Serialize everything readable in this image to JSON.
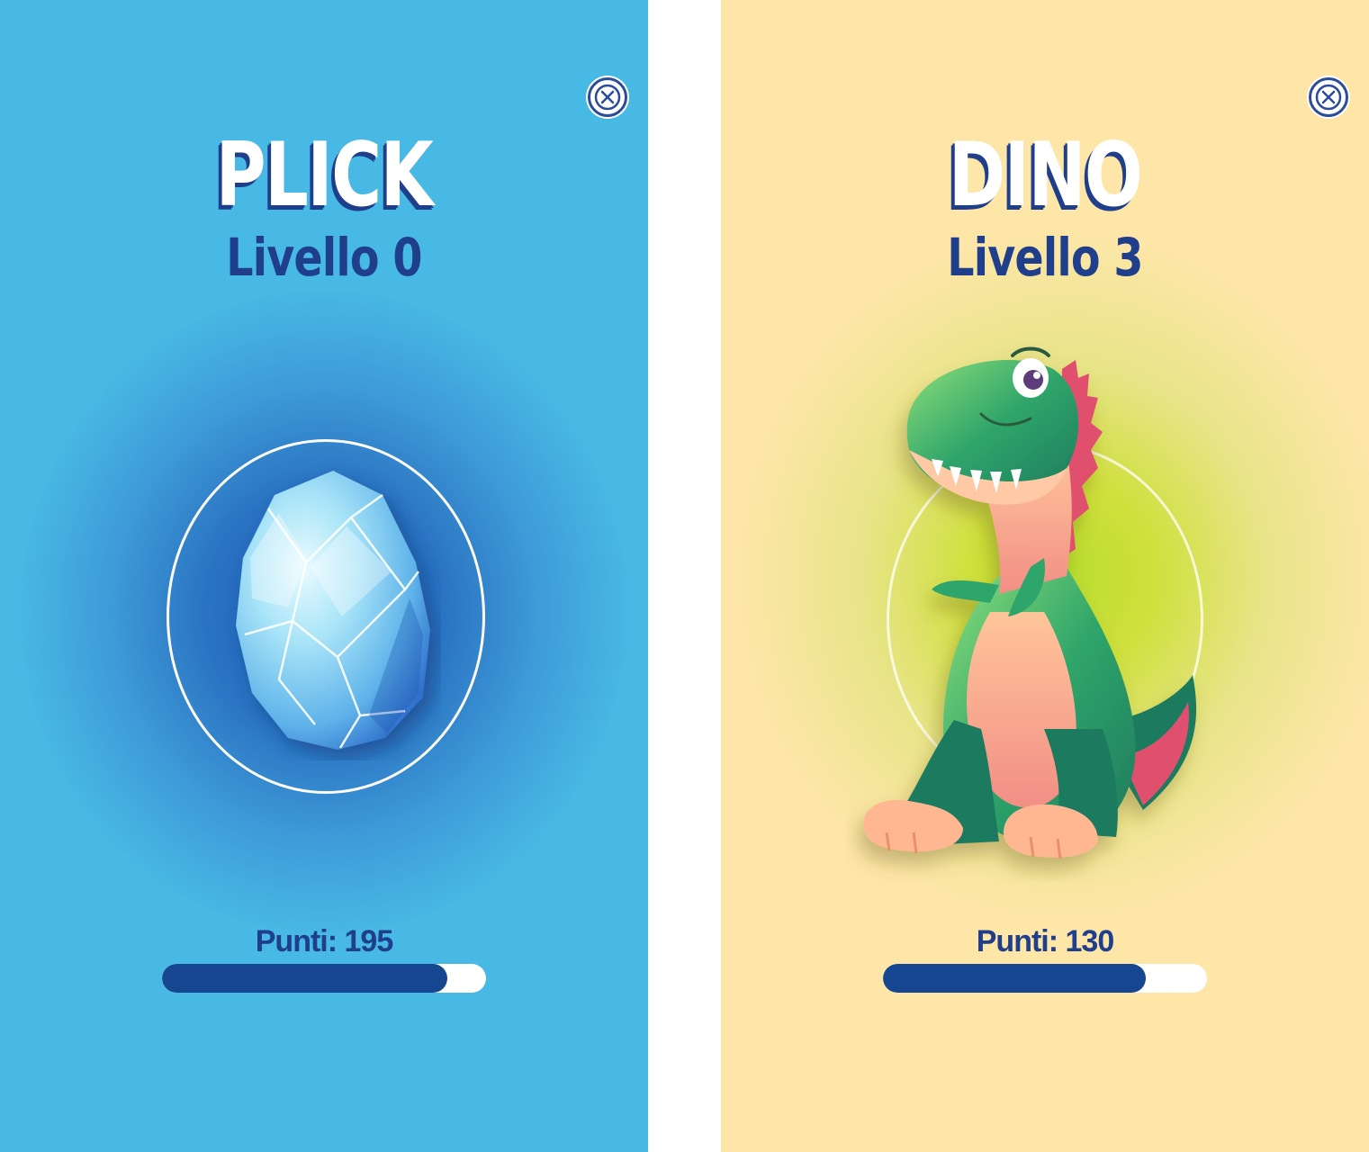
{
  "screens": [
    {
      "id": "plick",
      "name": "PLICK",
      "level_label": "Livello 0",
      "points_label": "Punti: 195",
      "progress": 0.88,
      "background": "#48b8e4",
      "creature": "crystal-egg"
    },
    {
      "id": "dino",
      "name": "DINO",
      "level_label": "Livello 3",
      "points_label": "Punti: 130",
      "progress": 0.81,
      "background": "#fde6a8",
      "creature": "green-t-rex"
    }
  ],
  "icons": {
    "close": "close-icon"
  },
  "colors": {
    "text_dark_blue": "#1f3e8c",
    "progress_fill": "#15468f",
    "progress_track": "#ffffff"
  }
}
